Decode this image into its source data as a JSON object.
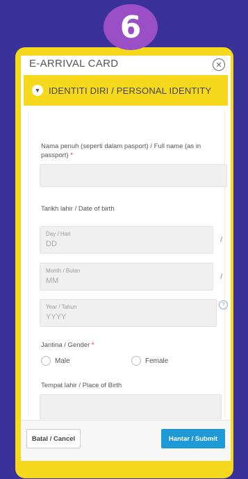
{
  "step_number": "6",
  "modal": {
    "title": "E-ARRIVAL CARD",
    "close_icon": "close-circle-icon"
  },
  "section": {
    "title": "IDENTITI DIRI / PERSONAL IDENTITY",
    "icon": "chevron-down-icon"
  },
  "form": {
    "full_name_label": "Nama penuh (seperti dalam pasport) / Full name (as in passport)",
    "required_mark": "*",
    "dob_label": "Tarikh lahir / Date of birth",
    "day_label": "Day / Hari",
    "day_placeholder": "DD",
    "month_label": "Month / Bulan",
    "month_placeholder": "MM",
    "year_label": "Year / Tahun",
    "year_placeholder": "YYYY",
    "separator": "/",
    "gender_label": "Jantina / Gender",
    "gender_options": [
      "Male",
      "Female"
    ],
    "birthplace_label": "Tempat lahir / Place of Birth"
  },
  "footer": {
    "cancel_label": "Batal / Cancel",
    "submit_label": "Hantar / Submit"
  },
  "colors": {
    "background": "#3a3299",
    "frame": "#f6d81d",
    "badge": "#9a4fc7",
    "submit": "#1e9ad6"
  }
}
